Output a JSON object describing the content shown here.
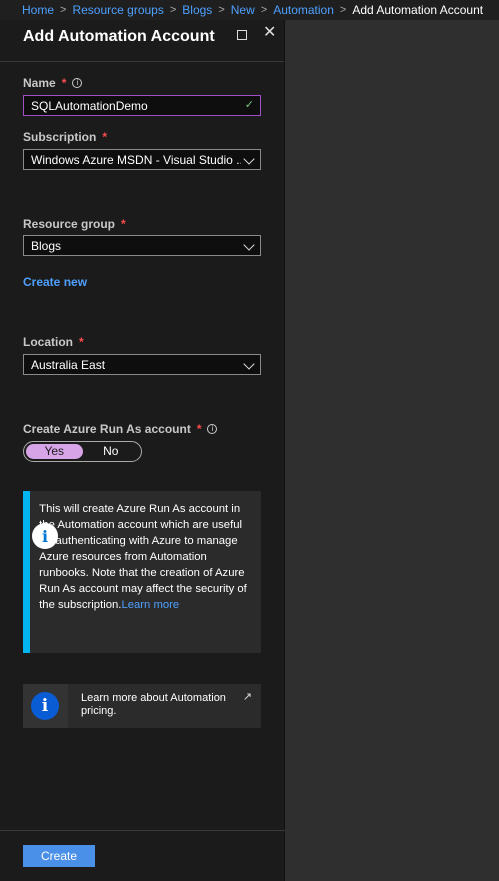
{
  "breadcrumb": {
    "items": [
      "Home",
      "Resource groups",
      "Blogs",
      "New",
      "Automation"
    ],
    "current": "Add Automation Account"
  },
  "blade": {
    "title": "Add Automation Account"
  },
  "form": {
    "name": {
      "label": "Name",
      "required_mark": "*",
      "value": "SQLAutomationDemo"
    },
    "subscription": {
      "label": "Subscription",
      "required_mark": "*",
      "value": "Windows Azure MSDN - Visual Studio ..."
    },
    "resource_group": {
      "label": "Resource group",
      "required_mark": "*",
      "value": "Blogs",
      "create_new": "Create new"
    },
    "location": {
      "label": "Location",
      "required_mark": "*",
      "value": "Australia East"
    },
    "run_as": {
      "label": "Create Azure Run As account",
      "required_mark": "*",
      "yes": "Yes",
      "no": "No",
      "selected": "Yes"
    }
  },
  "info_box": {
    "text": "This will create Azure Run As account in the Automation account which are useful for authenticating with Azure to manage Azure resources from Automation runbooks. Note that the creation of Azure Run As account may affect the security of the subscription.",
    "link": "Learn more"
  },
  "pricing_box": {
    "text": "Learn more about Automation pricing."
  },
  "footer": {
    "create_label": "Create"
  },
  "colors": {
    "accent": "#4a8fe8",
    "info_strip": "#00b5f0",
    "toggle_selected": "#d8a4e8",
    "required": "#ff4d4d"
  }
}
